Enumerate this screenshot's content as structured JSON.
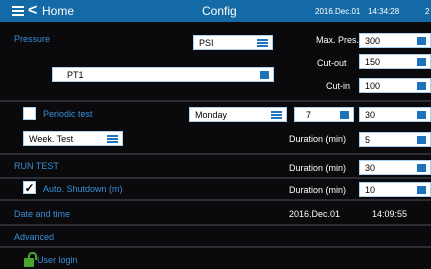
{
  "header": {
    "home_label": "Home",
    "title": "Config",
    "date": "2016.Dec.01",
    "time": "14:34:28",
    "extra": "2"
  },
  "pressure": {
    "label": "Pressure",
    "unit_value": "PSI",
    "sensor_value": "PT1",
    "max_label": "Max. Pres.",
    "max_value": "300",
    "cutout_label": "Cut-out",
    "cutout_value": "150",
    "cutin_label": "Cut-in",
    "cutin_value": "100"
  },
  "periodic": {
    "label": "Periodic test",
    "day_value": "Monday",
    "num_value": "7",
    "minutes_value": "30",
    "test_value": "Week. Test",
    "duration_label": "Duration (min)",
    "duration_value": "5"
  },
  "runtest": {
    "label": "RUN TEST",
    "duration_label": "Duration (min)",
    "duration_value": "30"
  },
  "autoshutdown": {
    "label": "Auto. Shutdown (m)",
    "check": "✓",
    "duration_label": "Duration (min)",
    "duration_value": "10"
  },
  "datetime": {
    "label": "Date and time",
    "date": "2016.Dec.01",
    "time": "14:09:55"
  },
  "advanced": {
    "label": "Advanced"
  },
  "login": {
    "label": "User login"
  },
  "colors": {
    "accent": "#136aa6",
    "label_blue": "#3a8fd8",
    "lock_green": "#49a52c"
  }
}
